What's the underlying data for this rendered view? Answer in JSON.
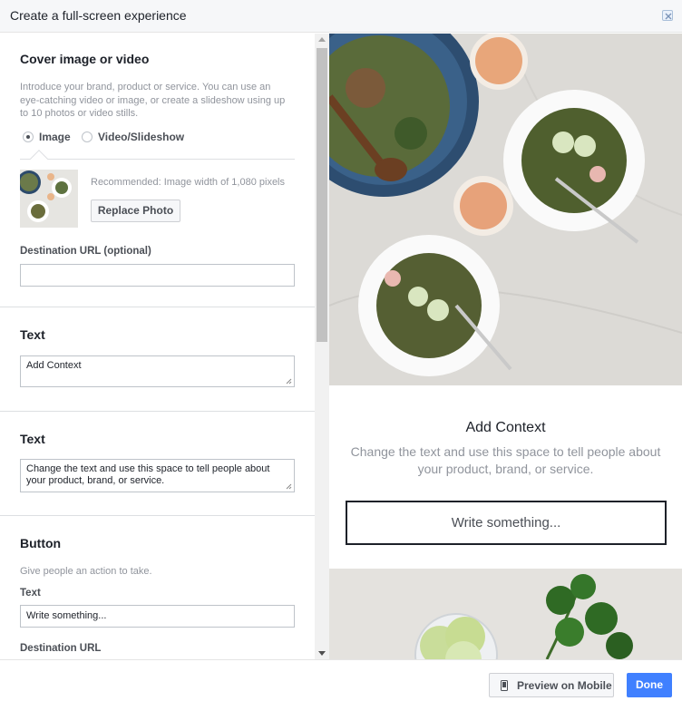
{
  "dialog": {
    "title": "Create a full-screen experience"
  },
  "cover": {
    "heading": "Cover image or video",
    "description": "Introduce your brand, product or service. You can use an eye-catching video or image, or create a slideshow using up to 10 photos or video stills.",
    "options": [
      {
        "label": "Image",
        "selected": true
      },
      {
        "label": "Video/Slideshow",
        "selected": false
      }
    ],
    "recommendation": "Recommended: Image width of 1,080 pixels",
    "replace_label": "Replace Photo",
    "destination_label": "Destination URL (optional)",
    "destination_value": ""
  },
  "text1": {
    "heading": "Text",
    "value": "Add Context"
  },
  "text2": {
    "heading": "Text",
    "value": "Change the text and use this space to tell people about your product, brand, or service."
  },
  "button_section": {
    "heading": "Button",
    "description": "Give people an action to take.",
    "text_label": "Text",
    "text_value": "Write something...",
    "destination_label": "Destination URL"
  },
  "preview": {
    "title": "Add Context",
    "description": "Change the text and use this space to tell people about your product, brand, or service.",
    "cta": "Write something..."
  },
  "footer": {
    "preview_mobile": "Preview on Mobile",
    "done": "Done"
  },
  "colors": {
    "primary": "#4080ff",
    "text": "#1d2129",
    "muted": "#90949c",
    "border": "#dddfe2"
  }
}
